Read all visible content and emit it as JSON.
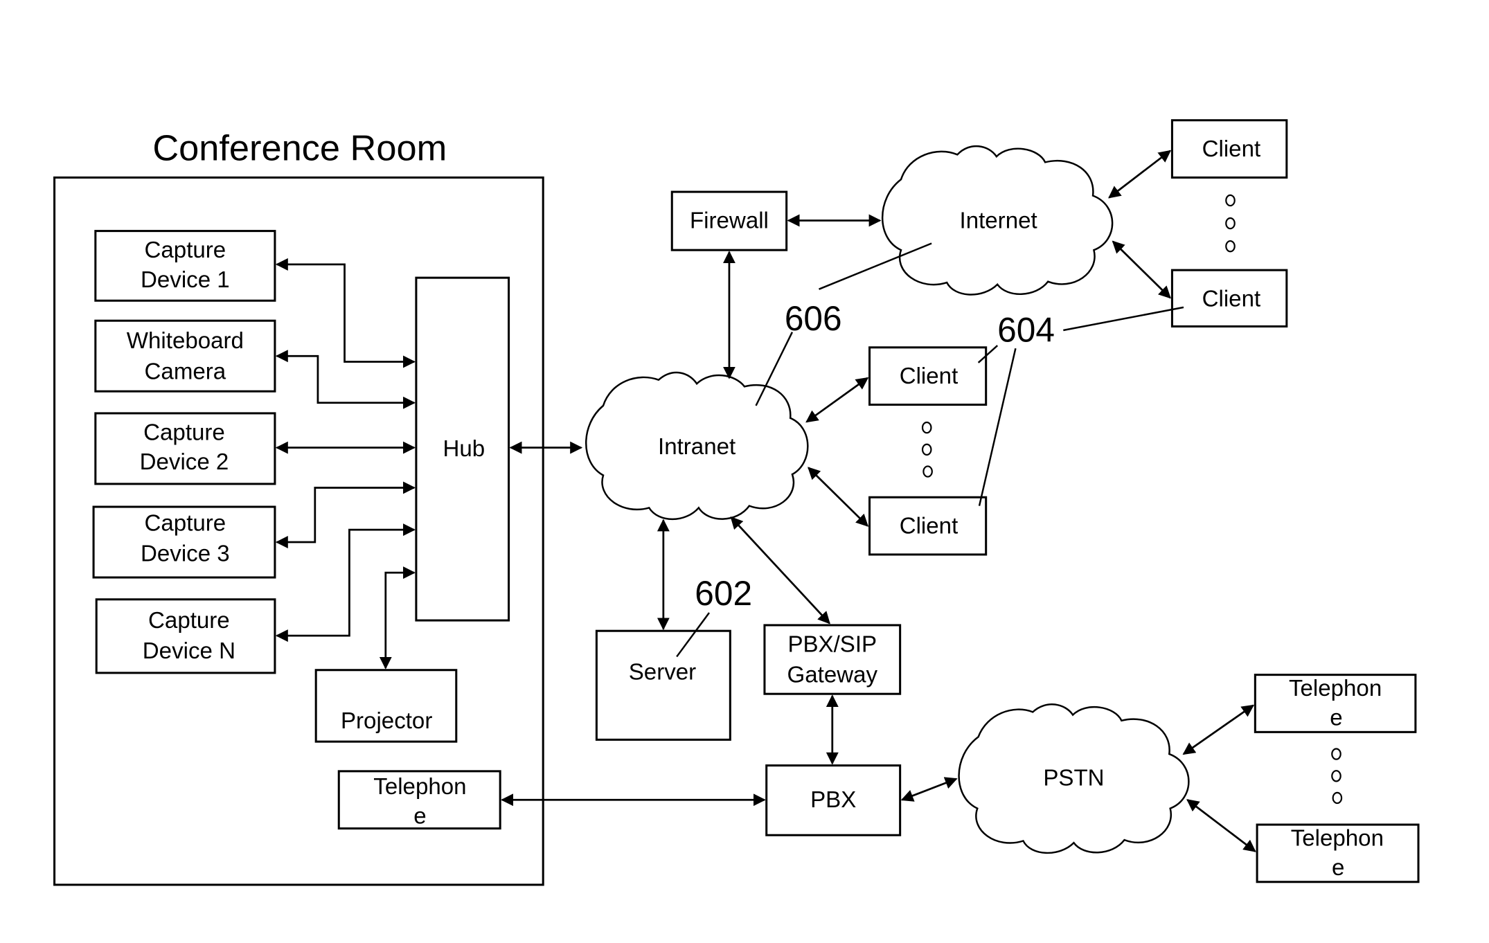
{
  "room": {
    "title": "Conference Room",
    "devices": [
      {
        "id": "capture-device-1",
        "lines": [
          "Capture",
          "Device 1"
        ]
      },
      {
        "id": "whiteboard-camera",
        "lines": [
          "Whiteboard",
          "Camera"
        ]
      },
      {
        "id": "capture-device-2",
        "lines": [
          "Capture",
          "Device 2"
        ]
      },
      {
        "id": "capture-device-3",
        "lines": [
          "Capture",
          "Device 3"
        ]
      },
      {
        "id": "capture-device-n",
        "lines": [
          "Capture",
          "Device N"
        ]
      }
    ],
    "hub": "Hub",
    "projector": "Projector",
    "telephone": [
      "Telephon",
      "e"
    ]
  },
  "network": {
    "intranet": "Intranet",
    "internet": "Internet",
    "pstn": "PSTN",
    "firewall": "Firewall",
    "server": "Server",
    "gateway": [
      "PBX/SIP",
      "Gateway"
    ],
    "pbx": "PBX",
    "internet_clients": [
      "Client",
      "Client"
    ],
    "intranet_clients": [
      "Client",
      "Client"
    ],
    "pstn_telephones": [
      [
        "Telephon",
        "e"
      ],
      [
        "Telephon",
        "e"
      ]
    ],
    "ellipsis_glyph": "o"
  },
  "reference_numerals": {
    "server_ref": "602",
    "client_ref": "604",
    "network_ref": "606"
  }
}
